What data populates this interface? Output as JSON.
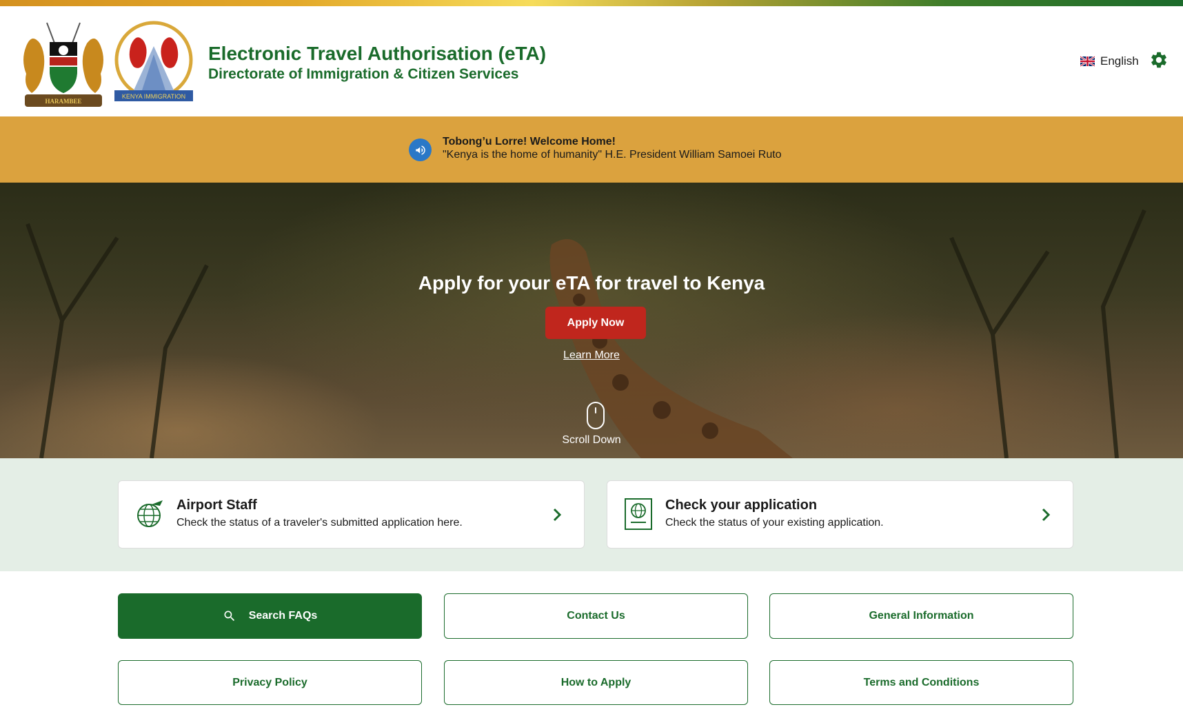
{
  "header": {
    "title": "Electronic Travel Authorisation (eTA)",
    "subtitle": "Directorate of Immigration & Citizen Services",
    "coat_of_arms_motto": "HARAMBEE",
    "immigration_logo_text": "KENYA IMMIGRATION",
    "language": {
      "label": "English",
      "flag_icon": "uk-flag-icon"
    },
    "settings_icon": "gear-icon"
  },
  "banner": {
    "icon": "megaphone-icon",
    "title": "Tobong’u Lorre! Welcome Home!",
    "quote": "\"Kenya is the home of humanity\" H.E. President William Samoei Ruto"
  },
  "hero": {
    "title": "Apply for your eTA for travel to Kenya",
    "apply_label": "Apply Now",
    "learn_more_label": "Learn More",
    "scroll_label": "Scroll Down"
  },
  "cards": [
    {
      "title": "Airport Staff",
      "description": "Check the status of a traveler's submitted application here.",
      "icon": "globe-plane-icon"
    },
    {
      "title": "Check your application",
      "description": "Check the status of your existing application.",
      "icon": "passport-icon"
    }
  ],
  "buttons": {
    "search_faqs": "Search FAQs",
    "contact_us": "Contact Us",
    "general_information": "General Information",
    "privacy_policy": "Privacy Policy",
    "how_to_apply": "How to Apply",
    "terms_and_conditions": "Terms and Conditions"
  },
  "colors": {
    "brand_green": "#1a6b2b",
    "banner_gold": "#dba23e",
    "apply_red": "#c0261d",
    "cards_band": "#e4eee6"
  }
}
